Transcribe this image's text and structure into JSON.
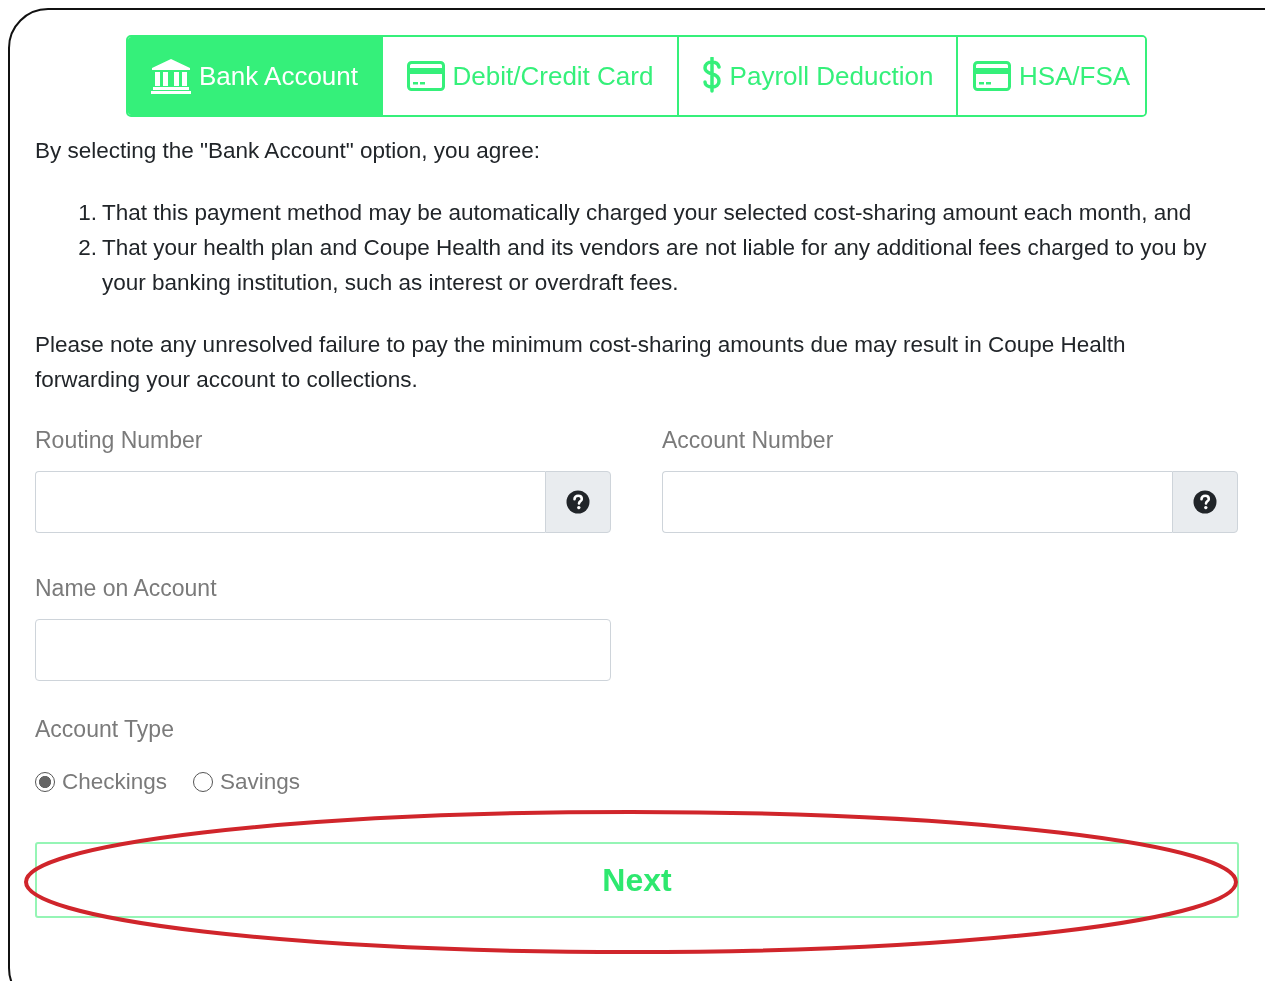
{
  "tabs": [
    {
      "label": "Bank Account",
      "kind": "bank",
      "selected": true
    },
    {
      "label": "Debit/Credit Card",
      "kind": "card",
      "selected": false
    },
    {
      "label": "Payroll Deduction",
      "kind": "dollar",
      "selected": false
    },
    {
      "label": "HSA/FSA",
      "kind": "card",
      "selected": false
    }
  ],
  "intro": "By selecting the \"Bank Account\" option, you agree:",
  "terms": [
    {
      "marker": "1.",
      "text": "That this payment method may be automatically charged your selected cost-sharing amount each month, and"
    },
    {
      "marker": "2.",
      "text": "That your health plan and Coupe Health and its vendors are not liable for any additional fees charged to you by your banking institution, such as interest or overdraft fees."
    }
  ],
  "note": "Please note any unresolved failure to pay the minimum cost-sharing amounts due may result in Coupe Health forwarding your account to collections.",
  "fields": [
    {
      "label": "Routing Number",
      "kind": "help"
    },
    {
      "label": "Account Number",
      "kind": "help"
    },
    {
      "label": "Name on Account",
      "kind": "plain"
    }
  ],
  "account_type": {
    "label": "Account Type",
    "options": [
      {
        "label": "Checkings",
        "selected": true
      },
      {
        "label": "Savings",
        "selected": false
      }
    ]
  },
  "next_button": "Next",
  "highlight": {
    "kind": "ellipse"
  }
}
